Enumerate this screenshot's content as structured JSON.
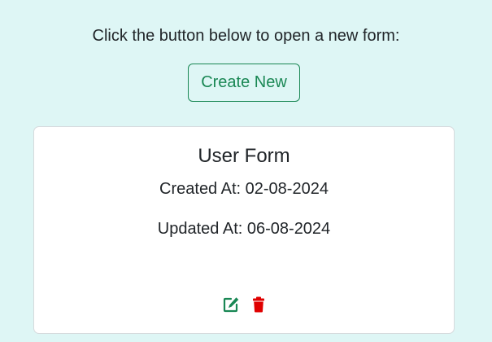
{
  "intro_text": "Click the button below to open a new form:",
  "create_button_label": "Create New",
  "card": {
    "title": "User Form",
    "created_at": "Created At: 02-08-2024",
    "updated_at": "Updated At: 06-08-2024",
    "actions": [
      {
        "icon": "edit-icon",
        "color": "#198754"
      },
      {
        "icon": "trash-icon",
        "color": "#e00000"
      }
    ]
  },
  "colors": {
    "page_background": "#def6f5",
    "accent": "#198754",
    "danger": "#e00000",
    "card_background": "#ffffff"
  }
}
